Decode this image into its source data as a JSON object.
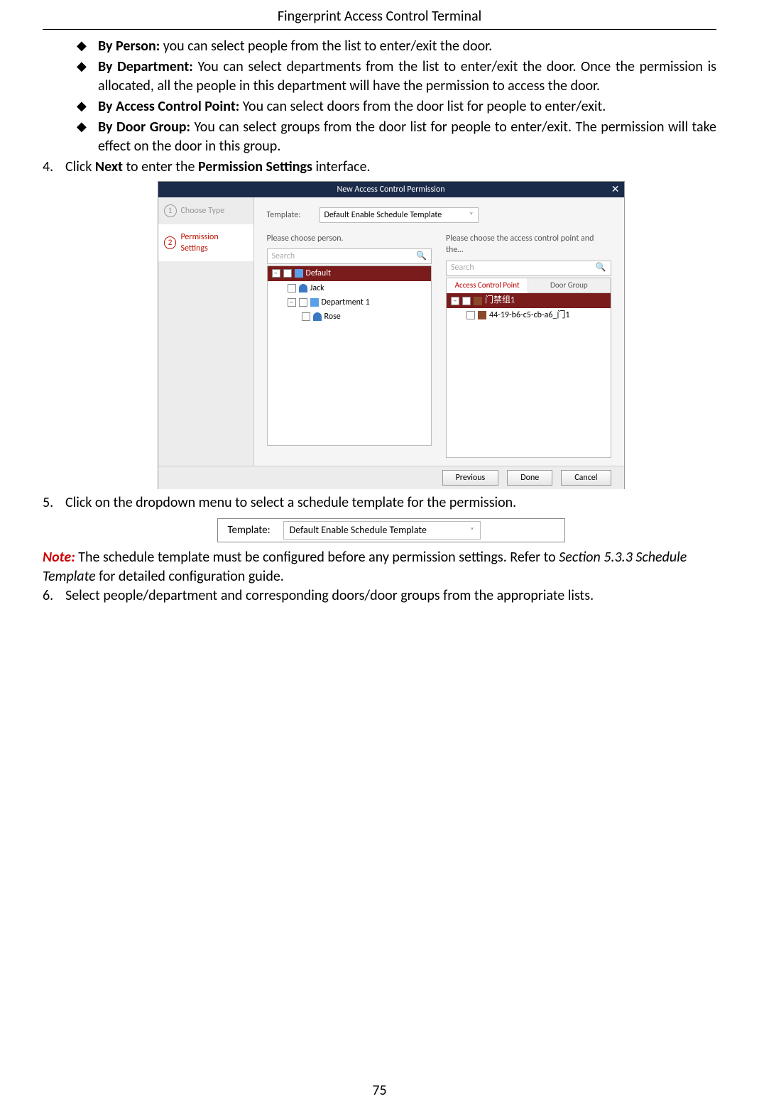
{
  "header": {
    "title": "Fingerprint Access Control Terminal"
  },
  "bullets": {
    "b1_bold": "By Person:",
    "b1_text": " you can select people from the list to enter/exit the door.",
    "b2_bold": "By Department:",
    "b2_text": " You can select departments from the list to enter/exit the door. Once the permission is allocated, all the people in this department will have the permission to access the door.",
    "b3_bold": "By Access Control Point:",
    "b3_text": " You can select doors from the door list for people to enter/exit.",
    "b4_bold": "By Door Group:",
    "b4_text": " You can select groups from the door list for people to enter/exit. The permission will take effect on the door in this group."
  },
  "steps": {
    "s4_num": "4.",
    "s4_a": "Click ",
    "s4_b": "Next",
    "s4_c": " to enter the ",
    "s4_d": "Permission Settings",
    "s4_e": " interface.",
    "s5_num": "5.",
    "s5_text": "Click on the dropdown menu to select a schedule template for the permission.",
    "s6_num": "6.",
    "s6_text": "Select people/department and corresponding doors/door groups from the appropriate lists."
  },
  "note": {
    "label": "Note:",
    "a": " The schedule template must be configured before any permission settings. Refer to ",
    "b": "Section 5.3.3 Schedule Template",
    "c": " for detailed configuration guide."
  },
  "dialog": {
    "title": "New Access Control Permission",
    "close": "✕",
    "step1_num": "1",
    "step1_label": "Choose Type",
    "step2_num": "2",
    "step2_label": "Permission Settings",
    "template_label": "Template:",
    "template_value": "Default Enable Schedule Template",
    "left_caption": "Please choose person.",
    "right_caption": "Please choose the access control point and the…",
    "search_placeholder": "Search",
    "tree_left": {
      "root": "Default",
      "n1": "Jack",
      "n2": "Department 1",
      "n3": "Rose"
    },
    "tabs": {
      "t1": "Access Control Point",
      "t2": "Door Group"
    },
    "tree_right": {
      "root": "门禁组1",
      "n1": "44-19-b6-c5-cb-a6_门1"
    },
    "buttons": {
      "prev": "Previous",
      "done": "Done",
      "cancel": "Cancel"
    }
  },
  "fig2": {
    "label": "Template:",
    "value": "Default Enable Schedule Template"
  },
  "page_number": "75"
}
